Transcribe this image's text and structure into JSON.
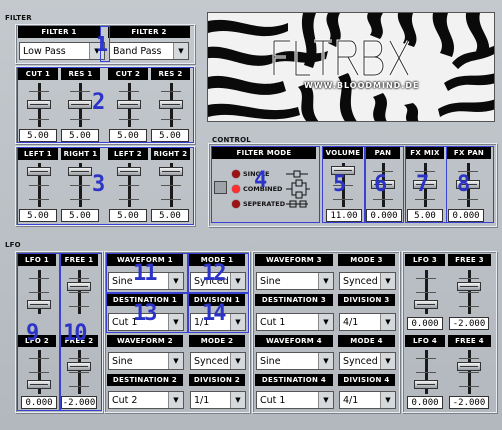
{
  "sections": {
    "filter": "FILTER",
    "control": "CONTROL",
    "lfo": "LFO"
  },
  "logo": {
    "title": "FLTRBX",
    "url": "WWW.BLOODMIND.DE"
  },
  "filter": {
    "filter1_label": "FILTER 1",
    "filter2_label": "FILTER 2",
    "filter1_value": "Low Pass",
    "filter2_value": "Band Pass",
    "cut1_label": "CUT 1",
    "res1_label": "RES 1",
    "cut2_label": "CUT 2",
    "res2_label": "RES 2",
    "cut1": "5.00",
    "res1": "5.00",
    "cut2": "5.00",
    "res2": "5.00",
    "left1_label": "LEFT 1",
    "right1_label": "RIGHT 1",
    "left2_label": "LEFT 2",
    "right2_label": "RIGHT 2",
    "left1": "5.00",
    "right1": "5.00",
    "left2": "5.00",
    "right2": "5.00"
  },
  "control": {
    "filter_mode_label": "FILTER MODE",
    "modes": [
      "SINGLE",
      "COMBINED",
      "SEPERATED"
    ],
    "volume_label": "VOLUME",
    "pan_label": "PAN",
    "fxmix_label": "FX MIX",
    "fxpan_label": "FX PAN",
    "volume": "11.00",
    "pan": "0.000",
    "fxmix": "5.00",
    "fxpan": "0.000"
  },
  "lfo": {
    "lfo1_label": "LFO 1",
    "free1_label": "FREE 1",
    "lfo2_label": "LFO 2",
    "free2_label": "FREE 2",
    "lfo3_label": "LFO 3",
    "free3_label": "FREE 3",
    "lfo4_label": "LFO 4",
    "free4_label": "FREE 4",
    "lfo1": "",
    "free1": "",
    "lfo2": "0.000",
    "free2": "-2.000",
    "lfo3": "0.000",
    "free3": "-2.000",
    "lfo4": "0.000",
    "free4": "-2.000",
    "waveform1_label": "WAVEFORM 1",
    "mode1_label": "MODE 1",
    "dest1_label": "DESTINATION 1",
    "div1_label": "DIVISION 1",
    "waveform2_label": "WAVEFORM 2",
    "mode2_label": "MODE 2",
    "dest2_label": "DESTINATION 2",
    "div2_label": "DIVISION 2",
    "waveform3_label": "WAVEFORM 3",
    "mode3_label": "MODE 3",
    "dest3_label": "DESTINATION 3",
    "div3_label": "DIVISION 3",
    "waveform4_label": "WAVEFORM 4",
    "mode4_label": "MODE 4",
    "dest4_label": "DESTINATION 4",
    "div4_label": "DIVISION 4",
    "waveform1": "Sine",
    "mode1": "Synced",
    "dest1": "Cut 1",
    "div1": "1/1",
    "waveform2": "Sine",
    "mode2": "Synced",
    "dest2": "Cut 2",
    "div2": "1/1",
    "waveform3": "Sine",
    "mode3": "Synced",
    "dest3": "Cut 1",
    "div3": "4/1",
    "waveform4": "Sine",
    "mode4": "Synced",
    "dest4": "Cut 1",
    "div4": "4/1"
  },
  "markers": [
    "1",
    "2",
    "3",
    "4",
    "5",
    "6",
    "7",
    "8",
    "9",
    "10",
    "11",
    "12",
    "13",
    "14"
  ]
}
